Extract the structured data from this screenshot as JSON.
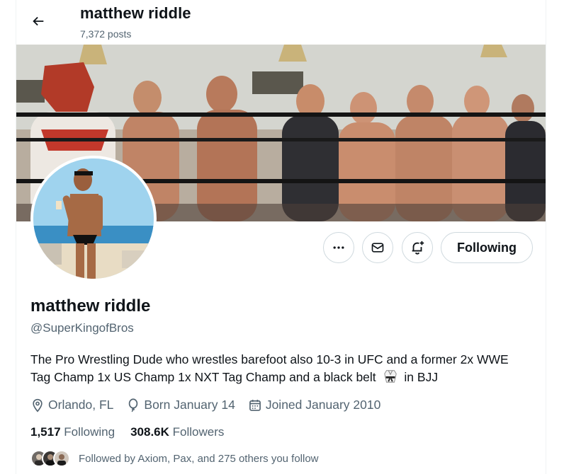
{
  "header": {
    "name": "matthew riddle",
    "posts": "7,372 posts"
  },
  "profile": {
    "name": "matthew riddle",
    "handle": "@SuperKingofBros",
    "bio_before": "The Pro Wrestling Dude who wrestles barefoot also 10-3 in UFC and a former 2x WWE Tag Champ 1x US Champ 1x NXT Tag Champ and a black belt",
    "bio_after": "in BJJ",
    "location": "Orlando, FL",
    "born": "Born January 14",
    "joined": "Joined January 2010"
  },
  "actions": {
    "follow_label": "Following"
  },
  "stats": {
    "following_count": "1,517",
    "following_label": "Following",
    "followers_count": "308.6K",
    "followers_label": "Followers"
  },
  "followed_by": {
    "text": "Followed by Axiom, Pax, and 275 others you follow"
  },
  "icons": [
    "back-arrow-icon",
    "more-icon",
    "message-icon",
    "notification-add-icon",
    "location-icon",
    "balloon-icon",
    "calendar-icon",
    "martial-arts-uniform-icon"
  ],
  "colors": {
    "text_primary": "#0f1419",
    "text_secondary": "#536471",
    "border": "#cfd9de"
  }
}
